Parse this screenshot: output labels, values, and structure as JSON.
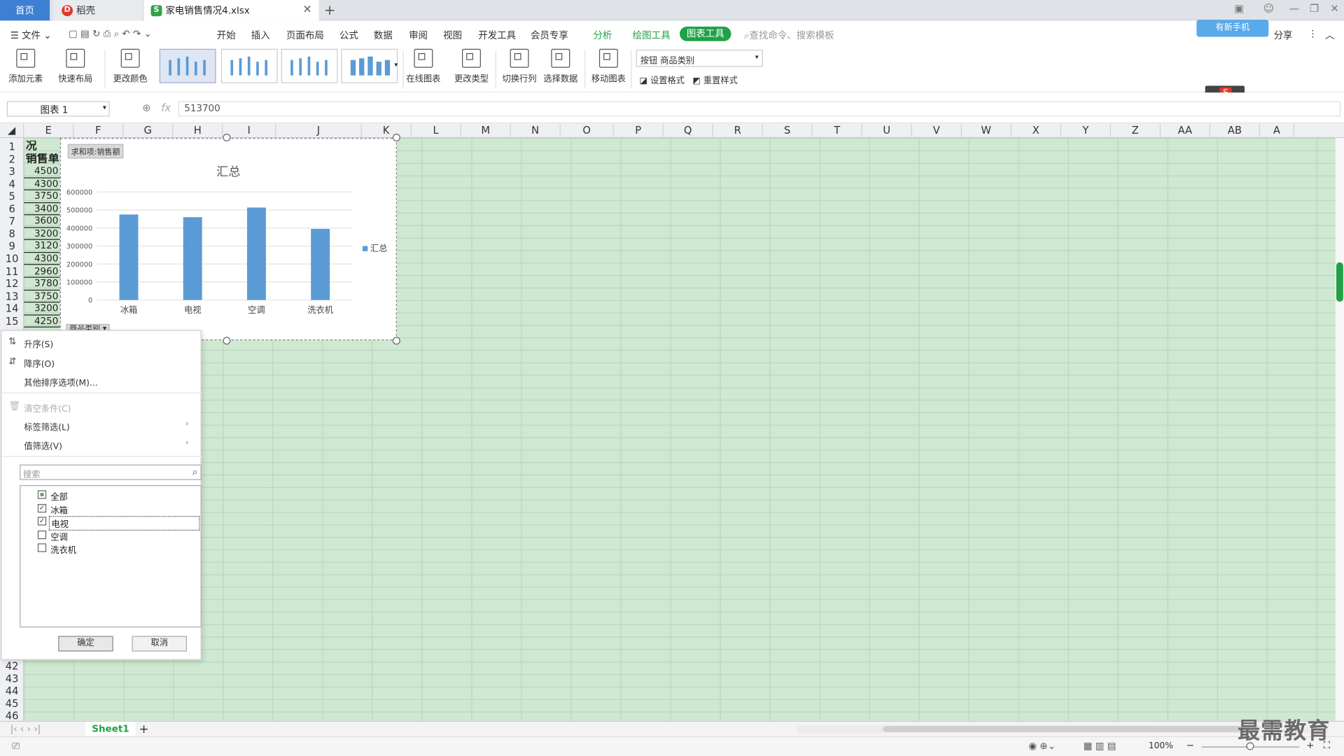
{
  "tabs": {
    "home": "首页",
    "daoke": "稻壳",
    "file": "家电销售情况4.xlsx"
  },
  "menu": {
    "items": [
      "文件",
      "开始",
      "插入",
      "页面布局",
      "公式",
      "数据",
      "审阅",
      "视图",
      "开发工具",
      "会员专享"
    ],
    "analysis": "分析",
    "drawing_tools": "绘图工具",
    "chart_tools": "图表工具",
    "search_placeholder": "查找命令、搜索模板",
    "share": "分享",
    "cloud_badge": "有新手机"
  },
  "ribbon": {
    "add_element": "添加元素",
    "quick_layout": "快速布局",
    "change_color": "更改颜色",
    "online_chart": "在线图表",
    "change_type": "更改类型",
    "switch_rowcol": "切换行列",
    "select_data": "选择数据",
    "move_chart": "移动图表",
    "series_select": "按钮 商品类别",
    "set_format": "设置格式",
    "reset_style": "重置样式"
  },
  "formula": {
    "name_box": "图表 1",
    "fx": "fx",
    "value": "513700"
  },
  "columns": [
    "E",
    "F",
    "G",
    "H",
    "I",
    "J",
    "K",
    "L",
    "M",
    "N",
    "O",
    "P",
    "Q",
    "R",
    "S",
    "T",
    "U",
    "V",
    "W",
    "X",
    "Y",
    "Z",
    "AA",
    "AB",
    "A"
  ],
  "rows_top": [
    "1",
    "2",
    "3",
    "4",
    "5",
    "6",
    "7",
    "8",
    "9",
    "10",
    "11",
    "12",
    "13",
    "14",
    "15"
  ],
  "rows_bottom": [
    "42",
    "43",
    "44",
    "45",
    "46"
  ],
  "cells_e": [
    "况",
    "销售单",
    "4500",
    "4300",
    "3750",
    "3400",
    "3600",
    "3200",
    "3120",
    "4300",
    "2960",
    "3780",
    "3750",
    "3200",
    "4250"
  ],
  "chart": {
    "field_value": "求和项:销售额",
    "field_category": "商品类别",
    "legend": "汇总"
  },
  "chart_data": {
    "type": "bar",
    "title": "汇总",
    "categories": [
      "冰箱",
      "电视",
      "空调",
      "洗衣机"
    ],
    "series": [
      {
        "name": "汇总",
        "values": [
          475000,
          460000,
          513700,
          395000
        ]
      }
    ],
    "ylim": [
      0,
      600000
    ],
    "yticks": [
      "600000",
      "500000",
      "400000",
      "300000",
      "200000",
      "100000",
      "0"
    ],
    "color": "#5b9bd5",
    "legend_position": "right",
    "grid": true
  },
  "dropdown": {
    "sort_asc": "升序(S)",
    "sort_desc": "降序(O)",
    "more_sort": "其他排序选项(M)...",
    "clear": "清空条件(C)",
    "label_filter": "标签筛选(L)",
    "value_filter": "值筛选(V)",
    "search_placeholder": "搜索",
    "items": [
      {
        "label": "全部",
        "state": "partial"
      },
      {
        "label": "冰箱",
        "state": "checked"
      },
      {
        "label": "电视",
        "state": "checked"
      },
      {
        "label": "空调",
        "state": "unchecked"
      },
      {
        "label": "洗衣机",
        "state": "unchecked"
      }
    ],
    "ok": "确定",
    "cancel": "取消"
  },
  "sheet": {
    "name": "Sheet1",
    "add": "+"
  },
  "status": {
    "zoom": "100%"
  },
  "watermark": "最需教育"
}
